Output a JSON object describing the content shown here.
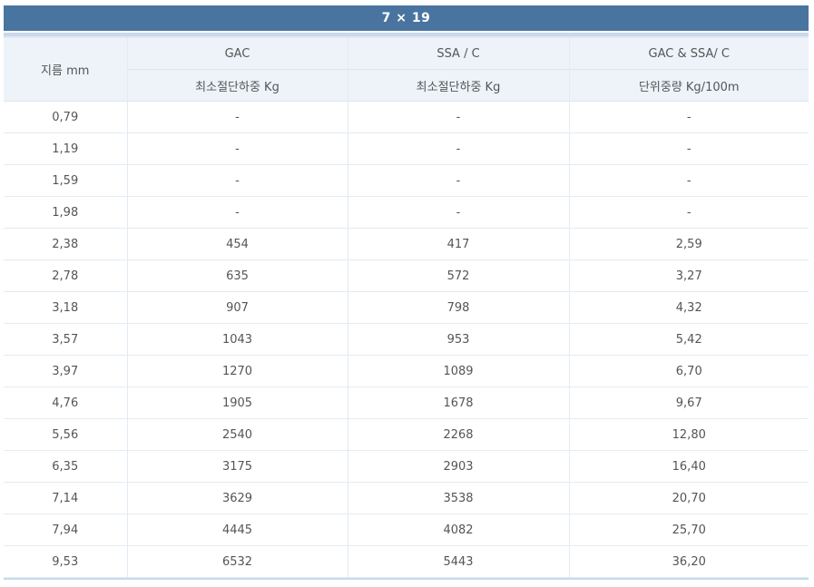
{
  "table_title": "7 × 19",
  "header": {
    "diameter": "지름 mm",
    "groups": [
      "GAC",
      "SSA / C",
      "GAC & SSA/ C"
    ],
    "subs": [
      "최소절단하중 Kg",
      "최소절단하중 Kg",
      "단위중량 Kg/100m"
    ]
  },
  "rows": [
    [
      "0,79",
      "-",
      "-",
      "-"
    ],
    [
      "1,19",
      "-",
      "-",
      "-"
    ],
    [
      "1,59",
      "-",
      "-",
      "-"
    ],
    [
      "1,98",
      "-",
      "-",
      "-"
    ],
    [
      "2,38",
      "454",
      "417",
      "2,59"
    ],
    [
      "2,78",
      "635",
      "572",
      "3,27"
    ],
    [
      "3,18",
      "907",
      "798",
      "4,32"
    ],
    [
      "3,57",
      "1043",
      "953",
      "5,42"
    ],
    [
      "3,97",
      "1270",
      "1089",
      "6,70"
    ],
    [
      "4,76",
      "1905",
      "1678",
      "9,67"
    ],
    [
      "5,56",
      "2540",
      "2268",
      "12,80"
    ],
    [
      "6,35",
      "3175",
      "2903",
      "16,40"
    ],
    [
      "7,14",
      "3629",
      "3538",
      "20,70"
    ],
    [
      "7,94",
      "4445",
      "4082",
      "25,70"
    ],
    [
      "9,53",
      "6532",
      "5443",
      "36,20"
    ]
  ],
  "colors": {
    "title_bg": "#4a74a0",
    "header_bg": "#eef3f9",
    "grid": "#e3ebf3"
  }
}
